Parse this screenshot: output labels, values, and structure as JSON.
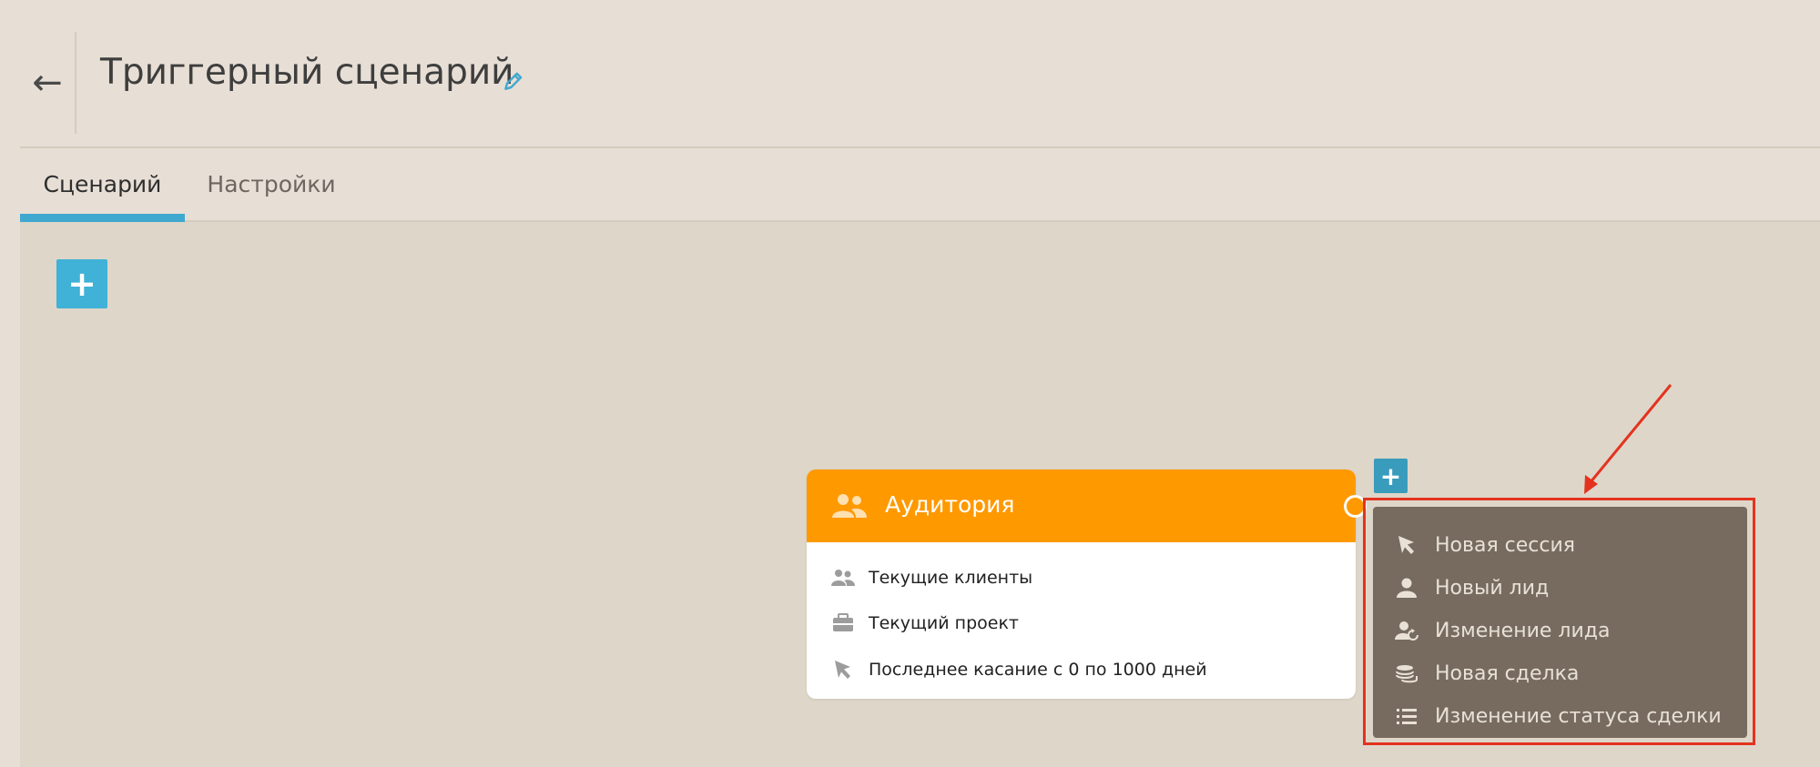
{
  "header": {
    "back_glyph": "←",
    "title": "Триггерный сценарий",
    "edit_icon": "pencil-icon"
  },
  "tabs": [
    {
      "label": "Сценарий",
      "active": true
    },
    {
      "label": "Настройки",
      "active": false
    }
  ],
  "canvas": {
    "add_glyph": "+",
    "node": {
      "title": "Аудитория",
      "header_color": "#ff9900",
      "rows": [
        {
          "icon": "users-icon",
          "label": "Текущие клиенты"
        },
        {
          "icon": "briefcase-icon",
          "label": "Текущий проект"
        },
        {
          "icon": "cursor-icon",
          "label": "Последнее касание с 0 по 1000 дней"
        }
      ]
    },
    "node_add_glyph": "+",
    "menu": {
      "items": [
        {
          "icon": "cursor-icon",
          "label": "Новая сессия"
        },
        {
          "icon": "user-icon",
          "label": "Новый лид"
        },
        {
          "icon": "user-refresh-icon",
          "label": "Изменение лида"
        },
        {
          "icon": "coins-icon",
          "label": "Новая сделка"
        },
        {
          "icon": "list-icon",
          "label": "Изменение статуса сделки"
        }
      ]
    }
  },
  "colors": {
    "accent": "#40b1d7",
    "annotation": "#e3331f",
    "menu_bg": "#766b5e",
    "page_bg": "#e7ded5"
  }
}
